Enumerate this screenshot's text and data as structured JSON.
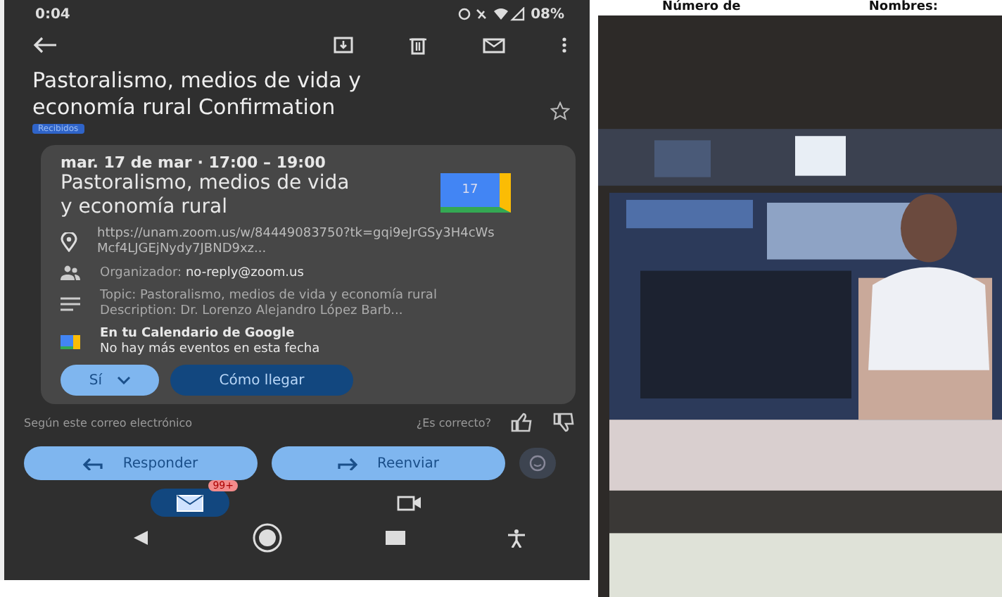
{
  "page_header": [
    "Número de",
    "Nombres:"
  ],
  "status_bar": {
    "time": "0:04",
    "battery": "08%"
  },
  "email": {
    "subject": "Pastoralismo, medios de vida y economía rural Confirmation",
    "label": "Recibidos",
    "starred": false
  },
  "event_card": {
    "date": "mar. 17 de mar · 17:00 – 19:00",
    "title": "Pastoralismo, medios de vida y economía rural",
    "calendar_day": "17",
    "link": "https://unam.zoom.us/w/84449083750?tk=gqi9eJrGSy3H4cWsMcf4LJGEjNydy7JBND9xz...",
    "organizer_label": "Organizador:",
    "organizer": "no-reply@zoom.us",
    "topic": "Topic: Pastoralismo, medios de vida y economía rural",
    "description": "Description: Dr. Lorenzo Alejandro López Barb...",
    "calendar_title": "En tu Calendario de Google",
    "calendar_note": "No hay más eventos en esta fecha",
    "rsvp": "Sí",
    "directions": "Cómo llegar"
  },
  "feedback": {
    "source": "Según este correo electrónico",
    "question": "¿Es correcto?"
  },
  "actions": [
    "Responder",
    "Reenviar"
  ],
  "bottom_nav": [
    {
      "kind": "mail",
      "badge": "99+",
      "selected": true
    },
    {
      "kind": "video",
      "selected": false
    }
  ]
}
